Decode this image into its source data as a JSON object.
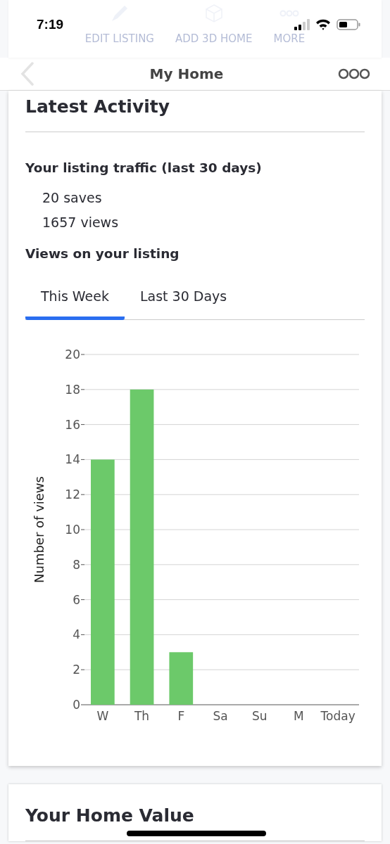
{
  "status_bar": {
    "time": "7:19"
  },
  "toolbar": {
    "actions": [
      {
        "label": "EDIT LISTING",
        "kind": "pencil"
      },
      {
        "label": "ADD 3D HOME",
        "kind": "cube"
      },
      {
        "label": "MORE",
        "kind": "dots"
      }
    ]
  },
  "nav": {
    "title": "My Home"
  },
  "latest_activity": {
    "title": "Latest Activity",
    "traffic_heading": "Your listing traffic (last 30 days)",
    "stats": [
      "20 saves",
      "1657 views"
    ],
    "views_heading": "Views on your listing",
    "tabs": [
      {
        "label": "This Week",
        "selected": true
      },
      {
        "label": "Last 30 Days",
        "selected": false
      }
    ],
    "chart_data": {
      "type": "bar",
      "ylabel": "Number of views",
      "categories": [
        "W",
        "Th",
        "F",
        "Sa",
        "Su",
        "M",
        "Today"
      ],
      "series": [
        {
          "color": "#6cc96a",
          "values": [
            14,
            18,
            3,
            0,
            0,
            0,
            0
          ]
        }
      ],
      "grid": true,
      "ylim": [
        0,
        20
      ],
      "yticks": [
        0,
        2,
        4,
        6,
        8,
        10,
        12,
        14,
        16,
        18,
        20
      ]
    }
  },
  "home_value": {
    "title": "Your Home Value"
  }
}
